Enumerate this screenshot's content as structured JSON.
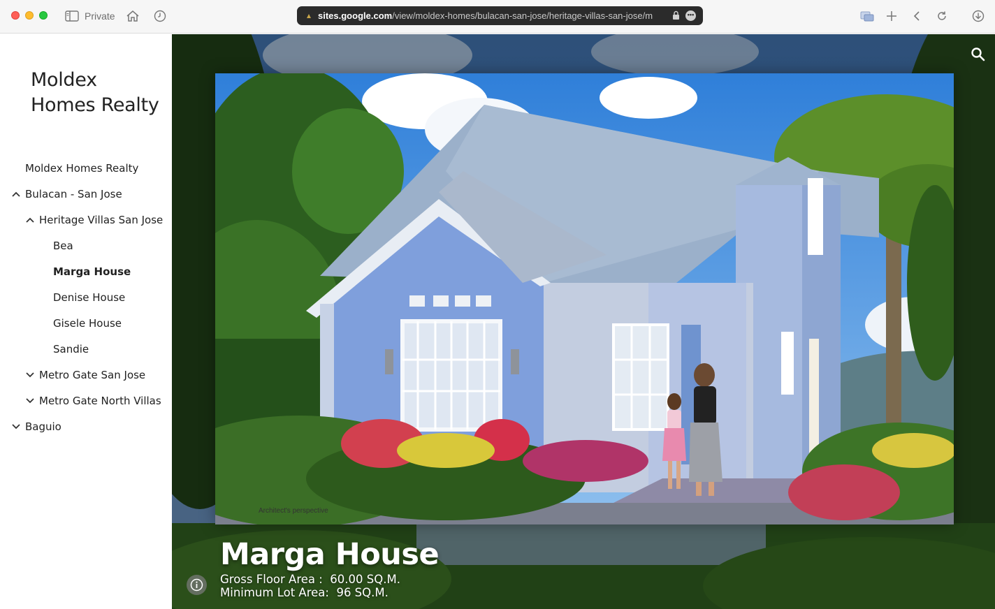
{
  "browser": {
    "private_label": "Private",
    "url_host": "sites.google.com",
    "url_path": "/view/moldex-homes/bulacan-san-jose/heritage-villas-san-jose/m"
  },
  "site": {
    "title": "Moldex Homes Realty"
  },
  "nav": {
    "items": [
      {
        "label": "Moldex Homes Realty"
      },
      {
        "label": "Bulacan - San Jose"
      },
      {
        "label": "Heritage Villas San Jose"
      },
      {
        "label": "Bea"
      },
      {
        "label": "Marga House"
      },
      {
        "label": "Denise House"
      },
      {
        "label": "Gisele House"
      },
      {
        "label": "Sandie"
      },
      {
        "label": "Metro Gate San Jose"
      },
      {
        "label": "Metro Gate North Villas"
      },
      {
        "label": "Baguio"
      }
    ]
  },
  "hero": {
    "title": "Marga House",
    "gross_floor_area": "Gross Floor Area :  60.00 SQ.M.",
    "minimum_lot_area": "Minimum Lot Area:  96 SQ.M.",
    "photo_caption": "Architect's perspective"
  },
  "colors": {
    "wall_blue": "#7f9fdc",
    "roof": "#9aaec8",
    "sky": "#4b8de0",
    "grass": "#2f6a22"
  },
  "icons": [
    "sidebar-icon",
    "home-icon",
    "history-icon",
    "lock-icon",
    "more-icon",
    "tabs-icon",
    "plus-icon",
    "back-icon",
    "reload-icon",
    "download-icon",
    "search-icon",
    "info-icon",
    "chevron-up-icon",
    "chevron-down-icon"
  ]
}
